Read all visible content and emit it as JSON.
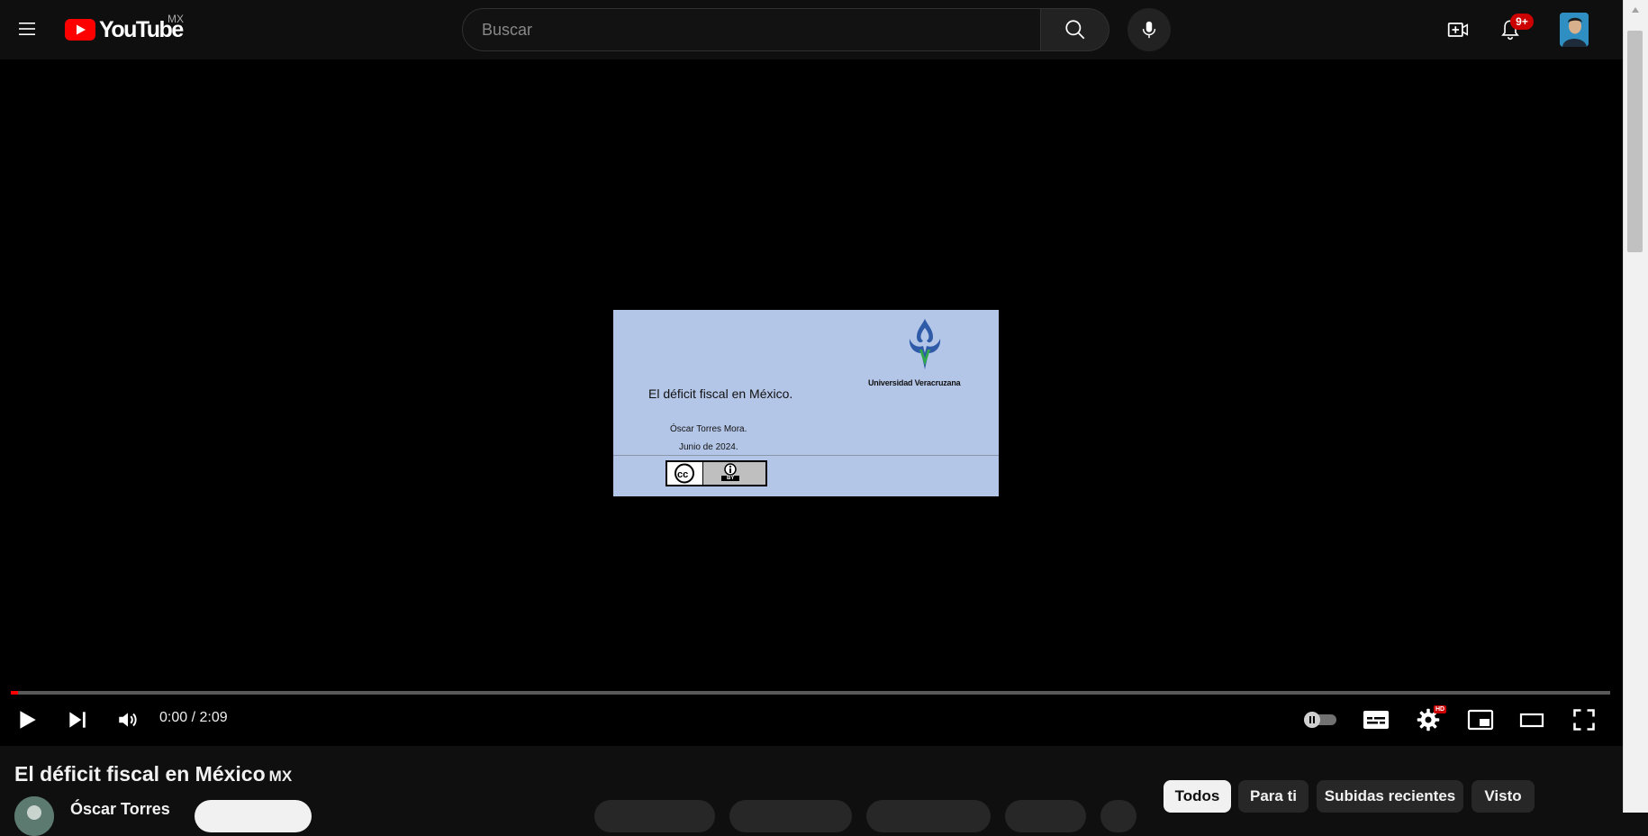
{
  "masthead": {
    "logo_text": "YouTube",
    "country_code": "MX",
    "search_placeholder": "Buscar",
    "notification_count": "9+"
  },
  "video_frame": {
    "slide_title": "El déficit fiscal en México.",
    "slide_author": "Óscar Torres Mora.",
    "slide_date": "Junio de 2024.",
    "institution": "Universidad Veracruzana",
    "license_label": "BY"
  },
  "player": {
    "time_display": "0:00 / 2:09",
    "progress_fraction": 0,
    "hd_badge": "HD"
  },
  "video_info": {
    "title": "El déficit fiscal en México",
    "title_suffix": "MX",
    "channel_name": "Óscar Torres"
  },
  "chips": [
    {
      "label": "Todos",
      "active": true
    },
    {
      "label": "Para ti",
      "active": false
    },
    {
      "label": "Subidas recientes",
      "active": false
    },
    {
      "label": "Visto",
      "active": false
    }
  ],
  "colors": {
    "accent_red": "#ff0000",
    "badge_red": "#cc0000",
    "background": "#0f0f0f",
    "slide_background": "#b4c6e7"
  },
  "icons": {
    "menu": "hamburger-menu-icon",
    "search": "search-icon",
    "mic": "microphone-icon",
    "create": "create-video-icon",
    "bell": "bell-icon",
    "play": "play-icon",
    "next": "next-icon",
    "volume": "volume-icon",
    "autoplay": "autoplay-toggle-icon",
    "subtitles": "subtitles-icon",
    "settings": "gear-icon",
    "miniplayer": "miniplayer-icon",
    "theater": "theater-mode-icon",
    "fullscreen": "fullscreen-icon"
  }
}
